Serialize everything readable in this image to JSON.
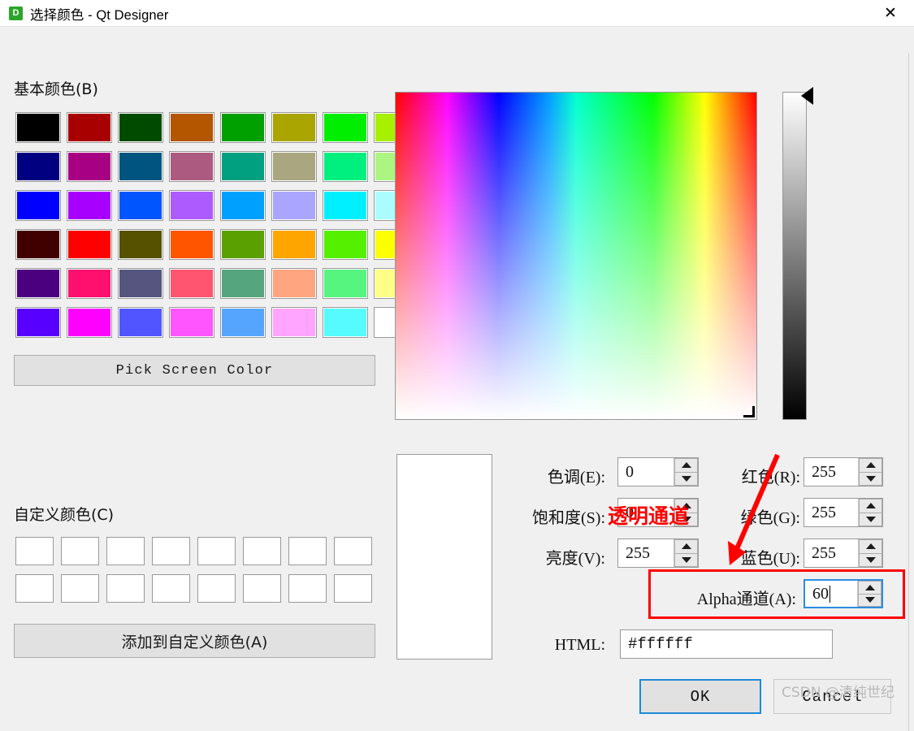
{
  "window": {
    "title": "选择颜色 - Qt Designer",
    "icon_letter": "D",
    "close_icon": "✕"
  },
  "basic_colors": {
    "label": "基本颜色(B)",
    "rows": [
      [
        "#000000",
        "#a80000",
        "#004b00",
        "#b45500",
        "#00a000",
        "#aaa500",
        "#00ef00",
        "#a6f000"
      ],
      [
        "#000080",
        "#a80085",
        "#005580",
        "#ad5a80",
        "#00a080",
        "#aaa680",
        "#00f080",
        "#abf580"
      ],
      [
        "#0000ff",
        "#a800ff",
        "#0055ff",
        "#ad5aff",
        "#00a0ff",
        "#aaa6ff",
        "#00f0ff",
        "#abfcff"
      ],
      [
        "#410000",
        "#ff0000",
        "#555100",
        "#ff5500",
        "#5aa000",
        "#ffa500",
        "#55f000",
        "#fbff00"
      ],
      [
        "#4b0080",
        "#ff0f6e",
        "#55557f",
        "#ff5570",
        "#55a57f",
        "#ffa57f",
        "#55f57f",
        "#fdff86"
      ],
      [
        "#5800ff",
        "#ff00ff",
        "#5055ff",
        "#ff55ff",
        "#55a5ff",
        "#ffa5ff",
        "#55fbff",
        "#ffffff"
      ]
    ]
  },
  "pick_screen_color": {
    "label": "Pick Screen Color"
  },
  "custom_colors": {
    "label": "自定义颜色(C)",
    "swatch_count": 16,
    "empty_color": "#ffffff",
    "add_button_label": "添加到自定义颜色(A)"
  },
  "fields": {
    "hue": {
      "label": "色调(E):",
      "value": "0"
    },
    "saturation": {
      "label": "饱和度(S):",
      "value": "0"
    },
    "value": {
      "label": "亮度(V):",
      "value": "255"
    },
    "red": {
      "label": "红色(R):",
      "value": "255"
    },
    "green": {
      "label": "绿色(G):",
      "value": "255"
    },
    "blue": {
      "label": "蓝色(U):",
      "value": "255"
    },
    "alpha": {
      "label": "Alpha通道(A):",
      "value": "60"
    },
    "html": {
      "label": "HTML:",
      "value": "#ffffff"
    }
  },
  "buttons": {
    "ok": "OK",
    "cancel": "Cancel"
  },
  "annotation": {
    "text": "透明通道",
    "color": "#ff0000"
  },
  "watermark": {
    "text": "CSDN @清纯世纪"
  },
  "preview": {
    "color": "#ffffff"
  }
}
